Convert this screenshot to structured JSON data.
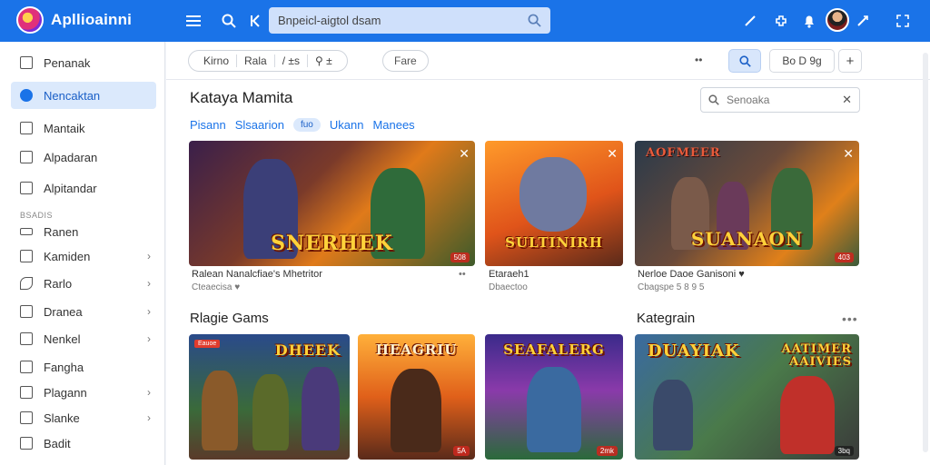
{
  "app": {
    "title": "Apllioainni"
  },
  "topbar": {
    "search_value": "Bnpeicl-aigtol dsam",
    "icons": [
      "menu-icon",
      "search-icon",
      "back-icon",
      "pen-icon",
      "puzzle-icon",
      "bell-icon",
      "avatar",
      "edit-icon",
      "expand-icon"
    ]
  },
  "sidebar": {
    "items": [
      {
        "label": "Penanak",
        "active": false
      },
      {
        "label": "Nencaktan",
        "active": true
      },
      {
        "label": "Mantaik",
        "active": false
      },
      {
        "label": "Alpadaran",
        "active": false
      },
      {
        "label": "Alpitandar",
        "active": false
      }
    ],
    "section_label": "BSADIS",
    "sub_items": [
      {
        "label": "Ranen",
        "chevron": false
      },
      {
        "label": "Kamiden",
        "chevron": true
      },
      {
        "label": "Rarlo",
        "chevron": true
      },
      {
        "label": "Dranea",
        "chevron": true
      },
      {
        "label": "Nenkel",
        "chevron": true
      },
      {
        "label": "Fangha",
        "chevron": false
      },
      {
        "label": "Plagann",
        "chevron": true
      },
      {
        "label": "Slanke",
        "chevron": true
      },
      {
        "label": "Badit",
        "chevron": false
      }
    ]
  },
  "toolbar": {
    "group": [
      "Kirno",
      "Rala",
      "/ ±s",
      "⚲ ±"
    ],
    "pill": "Fare",
    "dots": "••",
    "view_label": "Bo D  9g",
    "plus": "+"
  },
  "main": {
    "heading": "Kataya Mamita",
    "filter_placeholder": "Senoaka",
    "chips": [
      "Pisann",
      "Slsaarion",
      "fuo",
      "Ukann",
      "Manees"
    ],
    "featured": [
      {
        "art_title": "SNERHEK",
        "badge": "508",
        "meta": "Ralean  Nanalcfiae's Mhetritor",
        "sub": "Cteaecisa  ♥",
        "extra": "••"
      },
      {
        "art_title": "SULTINIRH",
        "badge": "",
        "meta": "Etaraeh1",
        "sub": "Dbaectoo"
      },
      {
        "art_title": "SUANAON",
        "top_title": "AOFMEER",
        "badge": "403",
        "meta": "Nerloe Daoe Ganisoni ♥",
        "sub": "Cbagspe 5  8 9  5"
      }
    ],
    "section2": "Rlagie Gams",
    "section3": "Kategrain",
    "more": "•••",
    "games": [
      {
        "art_title": "DHEEK",
        "tag": "Eauoe",
        "badge": ""
      },
      {
        "art_title": "HEAGRIU",
        "tag": "",
        "badge": "5A"
      },
      {
        "art_title": "SEAFALERG",
        "tag": "",
        "badge": "2mk"
      },
      {
        "art_title": "DUAYIAK",
        "art_title2": "AATIMER AAIVIES",
        "tag": "",
        "badge": "3bq"
      }
    ]
  },
  "colors": {
    "accent": "#1a73e8",
    "sidebar_active": "#dbe9fc",
    "chip": "#dbe9fc"
  }
}
